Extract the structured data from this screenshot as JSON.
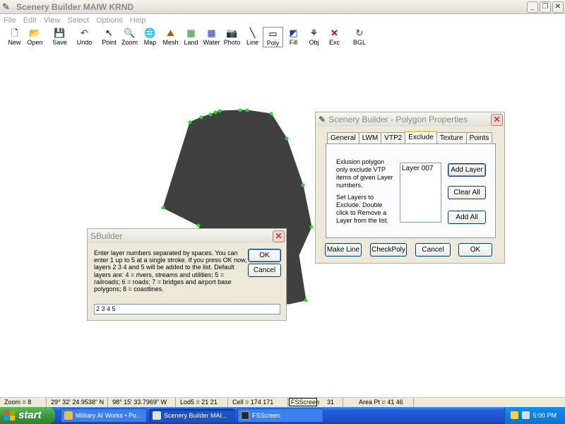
{
  "window": {
    "title": "Scenery Builder  MAIW KRND"
  },
  "menu": [
    "File",
    "Edit",
    "View",
    "Select",
    "Options",
    "Help"
  ],
  "toolbar": [
    {
      "id": "new",
      "label": "New",
      "icon": "new-file-icon",
      "glyph": "🗋"
    },
    {
      "id": "open",
      "label": "Open",
      "icon": "open-folder-icon",
      "glyph": "📂"
    },
    {
      "id": "save",
      "label": "Save",
      "icon": "save-disk-icon",
      "glyph": "💾"
    },
    {
      "id": "undo",
      "label": "Undo",
      "icon": "undo-arrow-icon",
      "glyph": "↶"
    },
    {
      "id": "point",
      "label": "Point",
      "icon": "pointer-arrow-icon",
      "glyph": "↖"
    },
    {
      "id": "zoom",
      "label": "Zoom",
      "icon": "magnifier-icon",
      "glyph": "🔍"
    },
    {
      "id": "map",
      "label": "Map",
      "icon": "globe-icon",
      "glyph": "🌐"
    },
    {
      "id": "mesh",
      "label": "Mesh",
      "icon": "mountain-icon",
      "glyph": "⛰"
    },
    {
      "id": "land",
      "label": "Land",
      "icon": "land-class-icon",
      "glyph": "▦"
    },
    {
      "id": "water",
      "label": "Water",
      "icon": "water-class-icon",
      "glyph": "▦"
    },
    {
      "id": "photo",
      "label": "Photo",
      "icon": "camera-icon",
      "glyph": "📷"
    },
    {
      "id": "line",
      "label": "Line",
      "icon": "line-tool-icon",
      "glyph": "╲"
    },
    {
      "id": "poly",
      "label": "Poly",
      "icon": "polygon-tool-icon",
      "glyph": "▭"
    },
    {
      "id": "fill",
      "label": "Fill",
      "icon": "fill-icon",
      "glyph": "◩"
    },
    {
      "id": "obj",
      "label": "Obj",
      "icon": "objects-tree-icon",
      "glyph": "⚘"
    },
    {
      "id": "exc",
      "label": "Exc",
      "icon": "exclusion-x-icon",
      "glyph": "✕"
    },
    {
      "id": "bgl",
      "label": "BGL",
      "icon": "compile-bgl-icon",
      "glyph": "↻"
    }
  ],
  "colors": {
    "polygon_fill": "#404040",
    "vertex": "#22dd22",
    "accent_tab": "#ffc83c"
  },
  "polygon_dialog": {
    "title": "Scenery Builder - Polygon Properties",
    "tabs": [
      "General",
      "LWM",
      "VTP2",
      "Exclude",
      "Texture",
      "Points"
    ],
    "active_tab": "Exclude",
    "desc1": "Exlusion polygon only exclude VTP items of given Layer numbers.",
    "desc2": "Set Layers to Exclude. Double click to Remove a Layer from the list.",
    "layers": [
      "Layer 007"
    ],
    "add_layer": "Add Layer",
    "clear_all": "Clear All",
    "add_all": "Add All",
    "make_line": "Make Line",
    "check_poly": "CheckPoly",
    "cancel": "Cancel",
    "ok": "OK"
  },
  "sbuilder_dialog": {
    "title": "SBuilder",
    "message": "Enter layer numbers separated by spaces. You can enter 1 up to 5 at a single stroke. If you press OK now, layers 2 3 4 and 5 will be added to the list. Default layers are: 4 = rivers, streams and utilities; 5 = railroads; 6 = roads; 7 = bridges and airport base polygons; 8 = coastlines.",
    "ok": "OK",
    "cancel": "Cancel",
    "input_value": "2 3 4 5"
  },
  "status": {
    "zoom": "Zoom = 8",
    "lat": "29° 32' 24.9538\" N",
    "lon": "98° 15' 33.7969\" W",
    "lod": "Lod5 = 21 21",
    "cell": "Cell = 174 171",
    "extra": "31",
    "area": "Area Pt = 41 46",
    "tooltip": "FSScreen"
  },
  "taskbar": {
    "start": "start",
    "tasks": [
      "Military AI Works • Po...",
      "Scenery Builder  MAI...",
      "FSScreen"
    ],
    "clock": "5:00 PM"
  }
}
